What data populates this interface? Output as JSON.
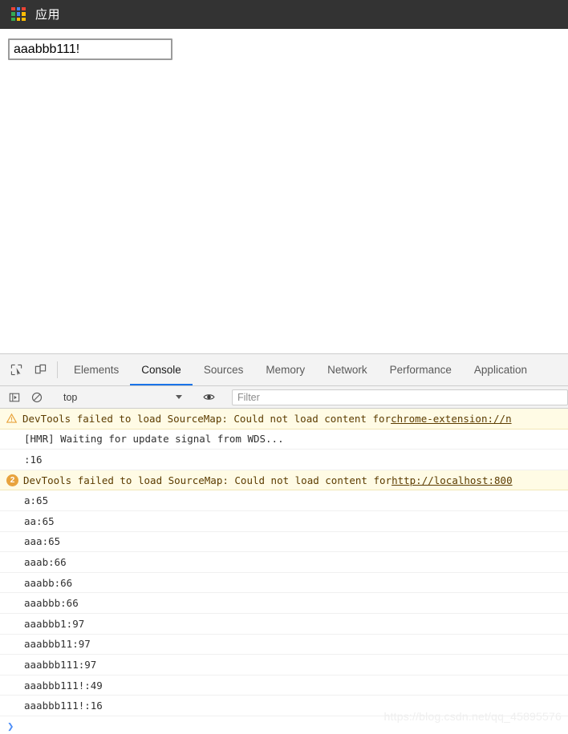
{
  "browser": {
    "bookmark_bar": {
      "apps_label": "应用",
      "apps_icon": "google-apps-grid-icon",
      "apps_icon_colors": [
        "#ea4335",
        "#4285f4",
        "#ea4335",
        "#34a853",
        "#4285f4",
        "#fbbc05",
        "#34a853",
        "#fbbc05",
        "#fbbc05"
      ],
      "background_color": "#333333"
    }
  },
  "page": {
    "input": {
      "value": "aaabbb111!",
      "placeholder": ""
    }
  },
  "devtools": {
    "toolbar": {
      "inspect_icon": "inspect-element-icon",
      "device_icon": "device-toolbar-icon",
      "tabs": [
        {
          "label": "Elements",
          "active": false
        },
        {
          "label": "Console",
          "active": true
        },
        {
          "label": "Sources",
          "active": false
        },
        {
          "label": "Memory",
          "active": false
        },
        {
          "label": "Network",
          "active": false
        },
        {
          "label": "Performance",
          "active": false
        },
        {
          "label": "Application",
          "active": false
        }
      ],
      "active_tab_accent": "#1a73e8"
    },
    "filterbar": {
      "sidebar_icon": "console-sidebar-icon",
      "clear_icon": "clear-console-icon",
      "context_value": "top",
      "eye_icon": "live-expression-eye-icon",
      "filter_placeholder": "Filter",
      "filter_value": ""
    },
    "console": {
      "warn_background": "#fffbe5",
      "warn_badge_color": "#e8a33d",
      "entries": [
        {
          "type": "warning",
          "badge": "warning-triangle-icon",
          "text": "DevTools failed to load SourceMap: Could not load content for ",
          "link": "chrome-extension://n"
        },
        {
          "type": "log",
          "badge": "",
          "text": "[HMR] Waiting for update signal from WDS...",
          "link": ""
        },
        {
          "type": "log",
          "badge": "",
          "text": ":16",
          "link": ""
        },
        {
          "type": "warning-count",
          "badge": "2",
          "text": "DevTools failed to load SourceMap: Could not load content for ",
          "link": "http://localhost:800"
        },
        {
          "type": "log",
          "badge": "",
          "text": "a:65",
          "link": ""
        },
        {
          "type": "log",
          "badge": "",
          "text": "aa:65",
          "link": ""
        },
        {
          "type": "log",
          "badge": "",
          "text": "aaa:65",
          "link": ""
        },
        {
          "type": "log",
          "badge": "",
          "text": "aaab:66",
          "link": ""
        },
        {
          "type": "log",
          "badge": "",
          "text": "aaabb:66",
          "link": ""
        },
        {
          "type": "log",
          "badge": "",
          "text": "aaabbb:66",
          "link": ""
        },
        {
          "type": "log",
          "badge": "",
          "text": "aaabbb1:97",
          "link": ""
        },
        {
          "type": "log",
          "badge": "",
          "text": "aaabbb11:97",
          "link": ""
        },
        {
          "type": "log",
          "badge": "",
          "text": "aaabbb111:97",
          "link": ""
        },
        {
          "type": "log",
          "badge": "",
          "text": "aaabbb111!:49",
          "link": ""
        },
        {
          "type": "log",
          "badge": "",
          "text": "aaabbb111!:16",
          "link": ""
        }
      ],
      "prompt_chevron": "❯"
    }
  },
  "watermark": {
    "text": "https://blog.csdn.net/qq_45895576"
  }
}
